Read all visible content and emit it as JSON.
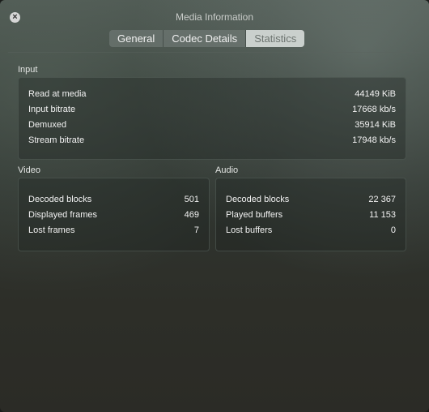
{
  "window": {
    "title": "Media Information",
    "close_icon": "close-icon"
  },
  "tabs": [
    {
      "label": "General",
      "active": false
    },
    {
      "label": "Codec Details",
      "active": false
    },
    {
      "label": "Statistics",
      "active": true
    }
  ],
  "input": {
    "title": "Input",
    "rows": [
      {
        "label": "Read at media",
        "value": "44149 KiB"
      },
      {
        "label": "Input bitrate",
        "value": "17668 kb/s"
      },
      {
        "label": "Demuxed",
        "value": "35914 KiB"
      },
      {
        "label": "Stream bitrate",
        "value": "17948 kb/s"
      }
    ]
  },
  "video": {
    "title": "Video",
    "rows": [
      {
        "label": "Decoded blocks",
        "value": "501"
      },
      {
        "label": "Displayed frames",
        "value": "469"
      },
      {
        "label": "Lost frames",
        "value": "7"
      }
    ]
  },
  "audio": {
    "title": "Audio",
    "rows": [
      {
        "label": "Decoded blocks",
        "value": "22 367"
      },
      {
        "label": "Played buffers",
        "value": "11 153"
      },
      {
        "label": "Lost buffers",
        "value": "0"
      }
    ]
  },
  "colors": {
    "active_tab_bg": "#dce1de",
    "active_tab_text": "#6d7470",
    "text": "#f2f2f2"
  }
}
